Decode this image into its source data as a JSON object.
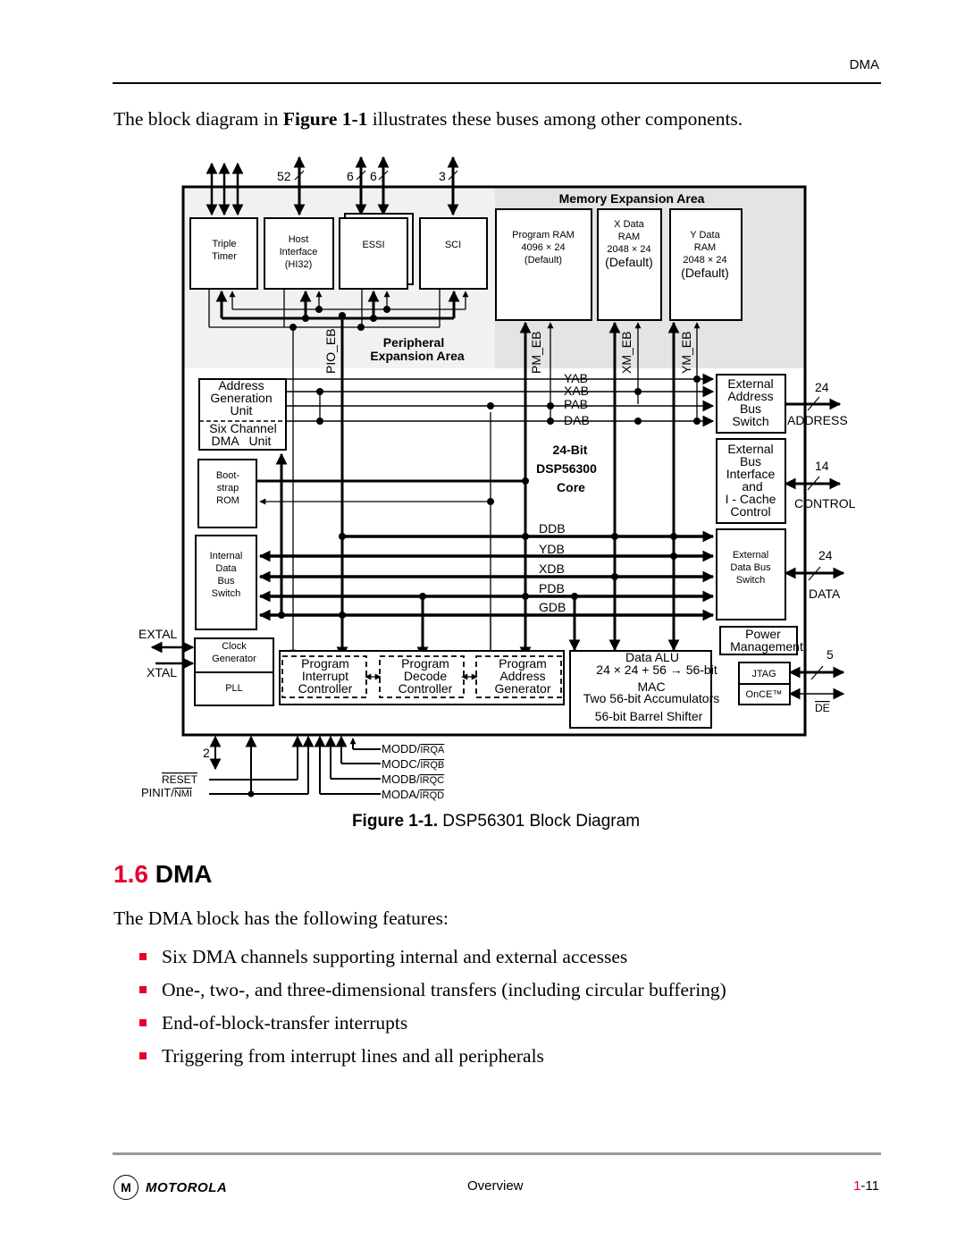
{
  "header": {
    "section": "DMA"
  },
  "intro": {
    "before": "The block diagram in ",
    "ref": "Figure 1-1",
    "after": " illustrates these buses among other components."
  },
  "figure": {
    "caption_label": "Figure 1-1.",
    "caption_text": " DSP56301 Block Diagram",
    "pin_counts": {
      "host": "52",
      "essi_a": "6",
      "essi_b": "6",
      "sci": "3",
      "address": "24",
      "control": "14",
      "data": "24",
      "jtag": "5",
      "reset_group": "2"
    },
    "peripherals": {
      "timer": [
        "Triple",
        "Timer"
      ],
      "host": [
        "Host",
        "Interface",
        "(HI32)"
      ],
      "essi": [
        "ESSI"
      ],
      "sci": [
        "SCI"
      ]
    },
    "memory_area_title": "Memory Expansion Area",
    "program_ram": [
      "Program RAM",
      "4096 × 24",
      "(Default)"
    ],
    "x_ram": [
      "X Data",
      "RAM",
      "2048 × 24",
      "(Default)"
    ],
    "y_ram": [
      "Y Data",
      "RAM",
      "2048 × 24",
      "(Default)"
    ],
    "bus_labels": {
      "pio": "PIO_EB",
      "pm": "PM_EB",
      "xm": "XM_EB",
      "ym": "YM_EB"
    },
    "peripheral_area_title": [
      "Peripheral",
      "Expansion Area"
    ],
    "agu": [
      "Address",
      "Generation",
      "Unit"
    ],
    "dma_unit": [
      "Six Channel",
      "DMA   Unit"
    ],
    "bootstrap": [
      "Boot-",
      "strap",
      "ROM"
    ],
    "idbs": [
      "Internal",
      "Data",
      "Bus",
      "Switch"
    ],
    "address_buses": [
      "YAB",
      "XAB",
      "PAB",
      "DAB"
    ],
    "data_buses": [
      "DDB",
      "YDB",
      "XDB",
      "PDB",
      "GDB"
    ],
    "core": [
      "24-Bit",
      "DSP56300",
      "Core"
    ],
    "ext_addr_switch": [
      "External",
      "Address",
      "Bus",
      "Switch"
    ],
    "ext_bus_iface": [
      "External",
      "Bus",
      "Interface",
      "and",
      "I - Cache",
      "Control"
    ],
    "ext_data_switch": [
      "External",
      "Data Bus",
      "Switch"
    ],
    "power": [
      "Power",
      "Management"
    ],
    "jtag": "JTAG",
    "once": "OnCE™",
    "ext_signals": {
      "address": "ADDRESS",
      "control": "CONTROL",
      "data": "DATA",
      "de": "DE"
    },
    "clock": {
      "gen": [
        "Clock",
        "Generator"
      ],
      "pll": "PLL",
      "extal": "EXTAL",
      "xtal": "XTAL"
    },
    "pic": [
      "Program",
      "Interrupt",
      "Controller"
    ],
    "pdc": [
      "Program",
      "Decode",
      "Controller"
    ],
    "pag": [
      "Program",
      "Address",
      "Generator"
    ],
    "alu": [
      "Data ALU",
      "24 × 24 + 56 → 56-bit",
      "MAC",
      "Two 56-bit Accumulators",
      "56-bit Barrel Shifter"
    ],
    "mode_pins": [
      {
        "mod": "MODD/",
        "irq": "IRQA"
      },
      {
        "mod": "MODC/",
        "irq": "IRQB"
      },
      {
        "mod": "MODB/",
        "irq": "IRQC"
      },
      {
        "mod": "MODA/",
        "irq": "IRQD"
      }
    ],
    "reset": "RESET",
    "pinit": {
      "a": "PINIT/",
      "b": "NMI"
    }
  },
  "section": {
    "number": "1.6",
    "title": " DMA"
  },
  "lead": "The DMA block has the following features:",
  "features": [
    "Six DMA channels supporting internal and external accesses",
    "One-, two-, and three-dimensional transfers (including circular buffering)",
    "End-of-block-transfer interrupts",
    "Triggering from interrupt lines and all peripherals"
  ],
  "footer": {
    "brand": "MOTOROLA",
    "center": "Overview",
    "page_chapter": "1",
    "page_rest": "-11"
  }
}
